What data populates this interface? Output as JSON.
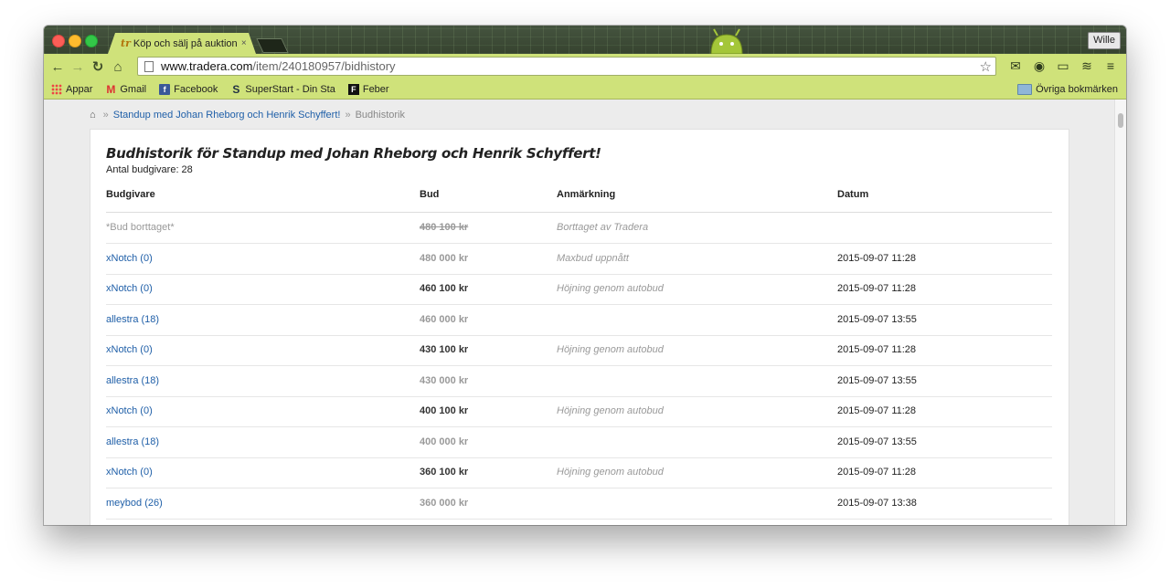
{
  "window": {
    "user_button": "Wille"
  },
  "tab": {
    "favicon": "tr",
    "title": "Köp och sälj på auktion &",
    "close": "×"
  },
  "toolbar": {
    "url_host": "www.tradera.com",
    "url_path": "/item/240180957/bidhistory",
    "back": "←",
    "forward": "→",
    "reload": "↻",
    "home": "⌂",
    "star": "☆",
    "gmail_ext": "✉",
    "ext2": "◉",
    "cast": "▭",
    "buffer": "≋",
    "menu": "≡"
  },
  "bookmarks": {
    "items": [
      {
        "icon": "apps-icon",
        "label": "Appar"
      },
      {
        "icon": "gmail-icon",
        "label": "Gmail"
      },
      {
        "icon": "facebook-icon",
        "label": "Facebook"
      },
      {
        "icon": "superstart-icon",
        "label": "SuperStart - Din Sta"
      },
      {
        "icon": "feber-icon",
        "label": "Feber"
      }
    ],
    "other": "Övriga bokmärken"
  },
  "breadcrumb": {
    "item_link": "Standup med Johan Rheborg och Henrik Schyffert!",
    "current": "Budhistorik",
    "separator": "»"
  },
  "page": {
    "title": "Budhistorik för Standup med Johan Rheborg och Henrik Schyffert!",
    "bidder_count": "Antal budgivare: 28"
  },
  "table": {
    "headers": [
      "Budgivare",
      "Bud",
      "Anmärkning",
      "Datum"
    ],
    "rows": [
      {
        "bidder": "*Bud borttaget*",
        "amount": "480 100 kr",
        "note": "Borttaget av Tradera",
        "date": "",
        "removed": true,
        "lead": false
      },
      {
        "bidder": "xNotch (0)",
        "amount": "480 000 kr",
        "note": "Maxbud uppnått",
        "date": "2015-09-07 11:28",
        "removed": false,
        "lead": false
      },
      {
        "bidder": "xNotch (0)",
        "amount": "460 100 kr",
        "note": "Höjning genom autobud",
        "date": "2015-09-07 11:28",
        "removed": false,
        "lead": true
      },
      {
        "bidder": "allestra (18)",
        "amount": "460 000 kr",
        "note": "",
        "date": "2015-09-07 13:55",
        "removed": false,
        "lead": false
      },
      {
        "bidder": "xNotch (0)",
        "amount": "430 100 kr",
        "note": "Höjning genom autobud",
        "date": "2015-09-07 11:28",
        "removed": false,
        "lead": true
      },
      {
        "bidder": "allestra (18)",
        "amount": "430 000 kr",
        "note": "",
        "date": "2015-09-07 13:55",
        "removed": false,
        "lead": false
      },
      {
        "bidder": "xNotch (0)",
        "amount": "400 100 kr",
        "note": "Höjning genom autobud",
        "date": "2015-09-07 11:28",
        "removed": false,
        "lead": true
      },
      {
        "bidder": "allestra (18)",
        "amount": "400 000 kr",
        "note": "",
        "date": "2015-09-07 13:55",
        "removed": false,
        "lead": false
      },
      {
        "bidder": "xNotch (0)",
        "amount": "360 100 kr",
        "note": "Höjning genom autobud",
        "date": "2015-09-07 11:28",
        "removed": false,
        "lead": true
      },
      {
        "bidder": "meybod (26)",
        "amount": "360 000 kr",
        "note": "",
        "date": "2015-09-07 13:38",
        "removed": false,
        "lead": false
      }
    ]
  },
  "colors": {
    "theme_green": "#cfe27a",
    "link_blue": "#1f5fa8"
  }
}
